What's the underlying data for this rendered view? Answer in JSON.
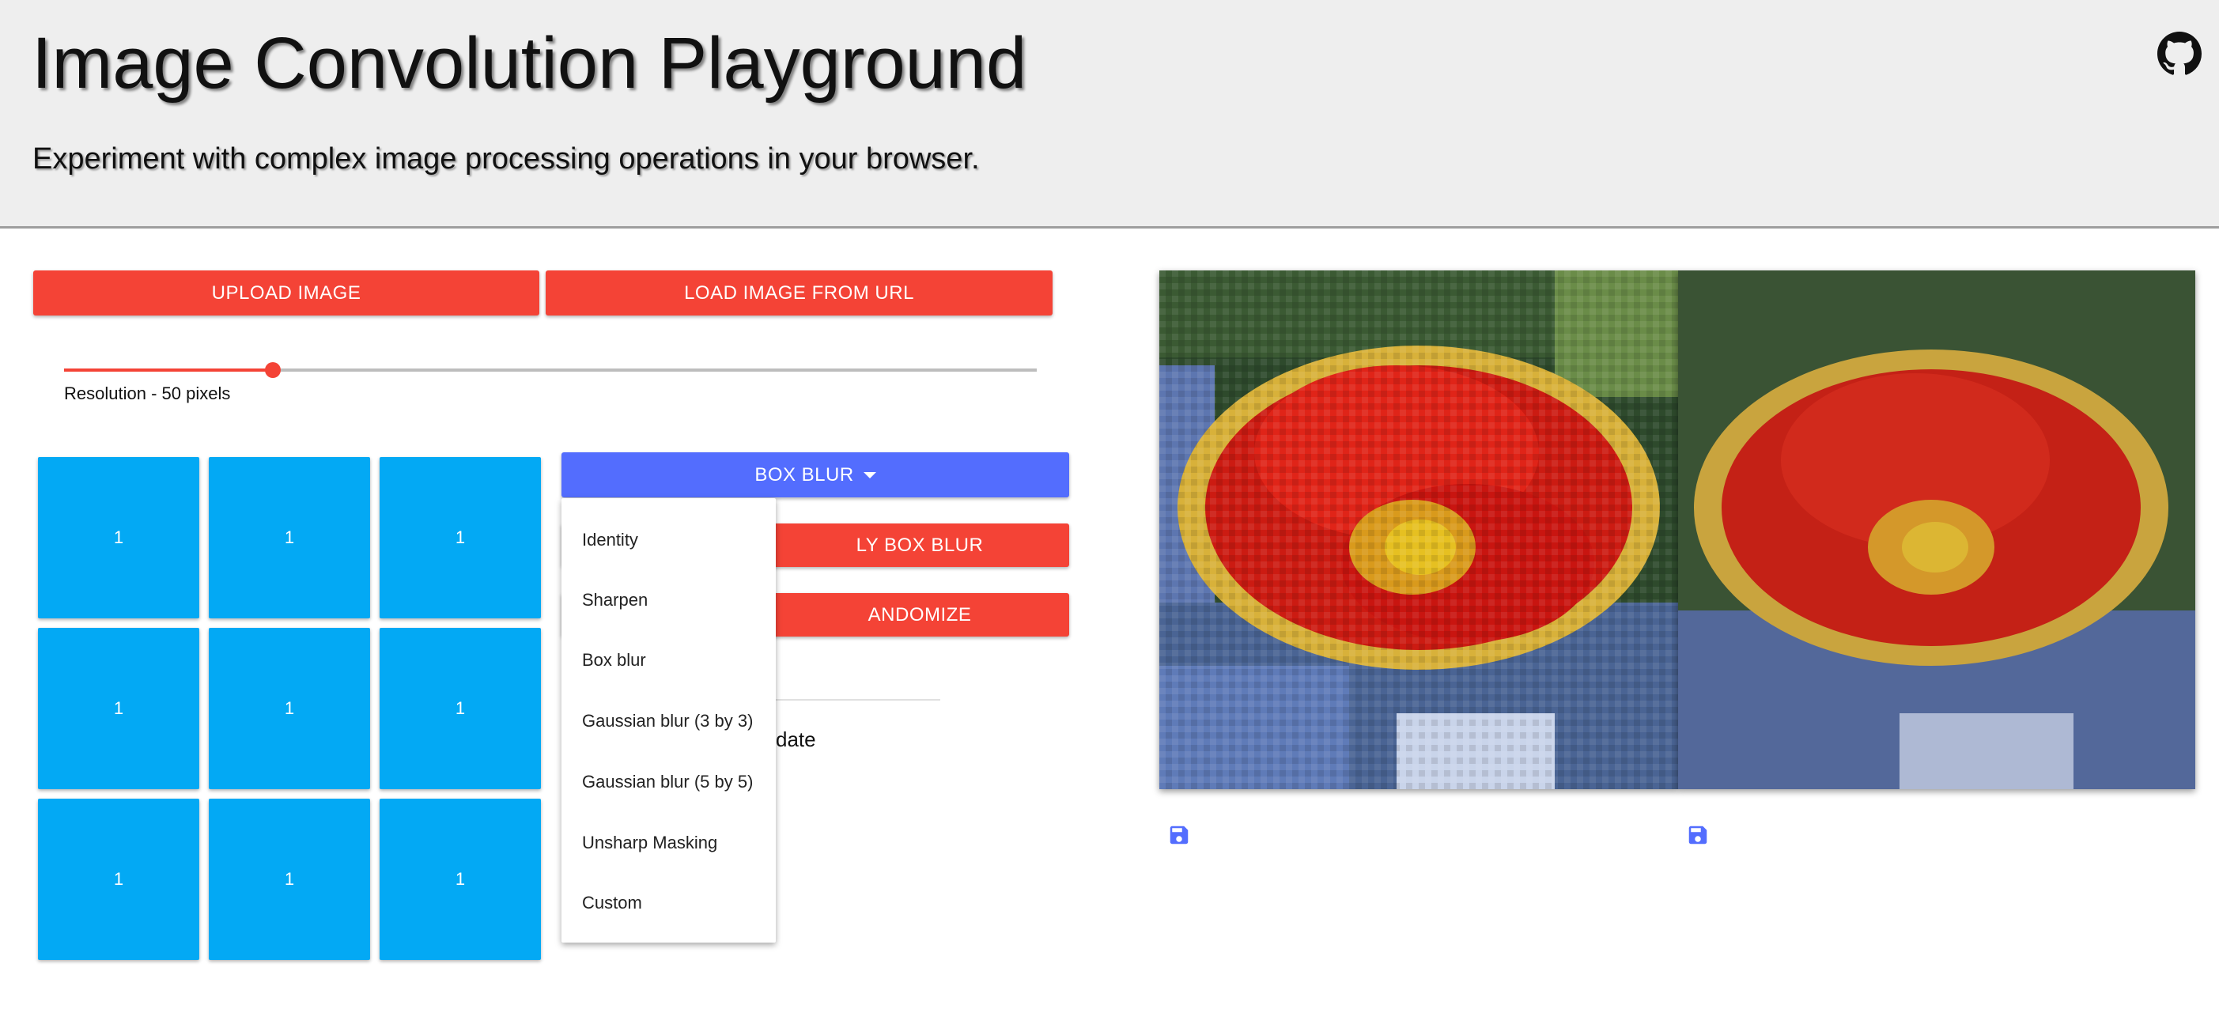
{
  "header": {
    "title": "Image Convolution Playground",
    "subtitle": "Experiment with complex image processing operations in your browser.",
    "github_icon": "github-icon"
  },
  "controls": {
    "upload_label": "Upload Image",
    "load_url_label": "Load Image From URL",
    "resolution_label": "Resolution - 50 pixels",
    "resolution_fraction": 0.215
  },
  "kernel": {
    "values": [
      [
        "1",
        "1",
        "1"
      ],
      [
        "1",
        "1",
        "1"
      ],
      [
        "1",
        "1",
        "1"
      ]
    ]
  },
  "preset": {
    "selected_label": "Box Blur",
    "dropdown_icon": "caret-down-icon",
    "apply_label": "ly Box Blur",
    "randomize_label": "andomize",
    "autoupdate_label": "date",
    "options": [
      "Identity",
      "Sharpen",
      "Box blur",
      "Gaussian blur (3 by 3)",
      "Gaussian blur (5 by 5)",
      "Unsharp Masking",
      "Custom"
    ]
  },
  "output": {
    "save_icon": "floppy-disk-icon"
  },
  "colors": {
    "accent_red": "#f44336",
    "accent_blue": "#536dfe",
    "kernel_cell": "#03a9f4"
  }
}
